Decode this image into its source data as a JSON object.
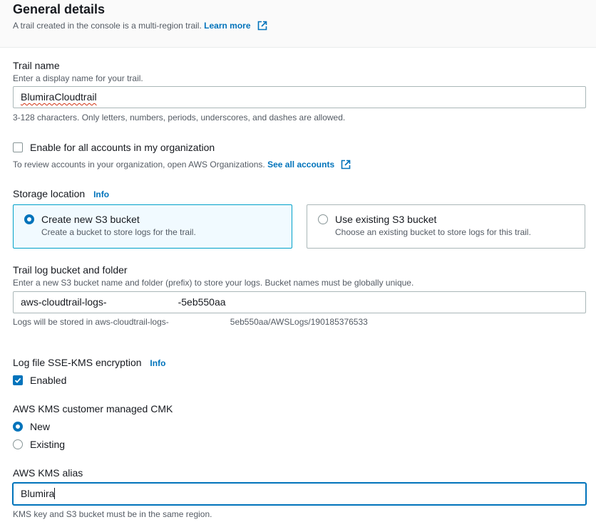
{
  "general": {
    "title": "General details",
    "subtitle": "A trail created in the console is a multi-region trail.",
    "learn_more": "Learn more"
  },
  "trail_name": {
    "label": "Trail name",
    "description": "Enter a display name for your trail.",
    "value": "BlumiraCloudtrail",
    "constraint": "3-128 characters. Only letters, numbers, periods, underscores, and dashes are allowed."
  },
  "org": {
    "checkbox_label": "Enable for all accounts in my organization",
    "checked": false,
    "description": "To review accounts in your organization, open AWS Organizations.",
    "see_all": "See all accounts"
  },
  "storage": {
    "label": "Storage location",
    "info": "Info",
    "options": [
      {
        "title": "Create new S3 bucket",
        "description": "Create a bucket to store logs for the trail.",
        "selected": true
      },
      {
        "title": "Use existing S3 bucket",
        "description": "Choose an existing bucket to store logs for this trail.",
        "selected": false
      }
    ]
  },
  "bucket": {
    "label": "Trail log bucket and folder",
    "description": "Enter a new S3 bucket name and folder (prefix) to store your logs. Bucket names must be globally unique.",
    "value_start": "aws-cloudtrail-logs-",
    "value_end": "-5eb550aa",
    "hint_start": "Logs will be stored in aws-cloudtrail-logs-",
    "hint_end": "5eb550aa/AWSLogs/190185376533"
  },
  "encryption": {
    "label": "Log file SSE-KMS encryption",
    "info": "Info",
    "enabled_label": "Enabled",
    "enabled": true
  },
  "cmk": {
    "label": "AWS KMS customer managed CMK",
    "options": [
      {
        "label": "New",
        "selected": true
      },
      {
        "label": "Existing",
        "selected": false
      }
    ]
  },
  "alias": {
    "label": "AWS KMS alias",
    "value": "Blumira",
    "hint": "KMS key and S3 bucket must be in the same region."
  },
  "colors": {
    "link": "#0073bb",
    "selected_tile_bg": "#f1faff",
    "selected_tile_border": "#00a1c9"
  }
}
